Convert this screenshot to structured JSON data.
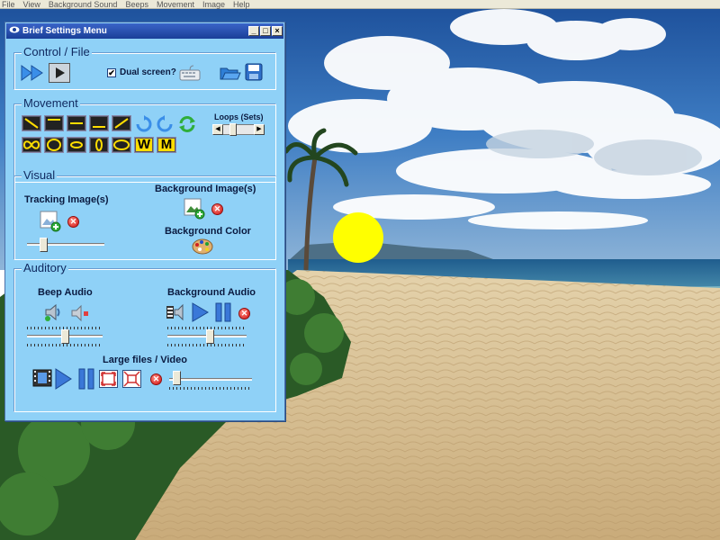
{
  "menubar": {
    "items": [
      "File",
      "View",
      "Background Sound",
      "Beeps",
      "Movement",
      "Image",
      "Help"
    ]
  },
  "window": {
    "title": "Brief Settings Menu",
    "controls": {
      "minimize": "_",
      "maximize": "□",
      "close": "×"
    }
  },
  "control_file": {
    "title": "Control / File",
    "dual_screen_label": "Dual screen?",
    "dual_screen_checked": true,
    "check_mark": "✔"
  },
  "movement": {
    "title": "Movement",
    "loops_label": "Loops (Sets)",
    "loop_left": "◀",
    "loop_right": "▶",
    "loop_level": 0.35,
    "patterns_row1": [
      "diagonal-down",
      "top-line",
      "middle-line",
      "bottom-line",
      "diagonal-up"
    ],
    "patterns_row2": [
      "infinity",
      "circle",
      "small-oval",
      "vertical-oval",
      "horizontal-oval",
      "w-shape",
      "m-shape"
    ],
    "pattern_letters": {
      "w": "W",
      "m": "M"
    },
    "rotate_icons": [
      "rotate-cw-icon",
      "rotate-ccw-icon",
      "refresh-icon"
    ]
  },
  "visual": {
    "title": "Visual",
    "tracking_label": "Tracking Image(s)",
    "background_image_label": "Background Image(s)",
    "background_color_label": "Background Color",
    "tracking_size_level": 0.18
  },
  "auditory": {
    "title": "Auditory",
    "beep_label": "Beep Audio",
    "background_audio_label": "Background Audio",
    "large_files_label": "Large files / Video",
    "beep_volume_level": 0.5,
    "background_volume_level": 0.55,
    "video_position_level": 0.05,
    "remove_glyph": "✕"
  },
  "scene": {
    "ball_color": "#ffff00",
    "sky_color": "#3a72b8",
    "sand_color": "#d6bf94"
  }
}
